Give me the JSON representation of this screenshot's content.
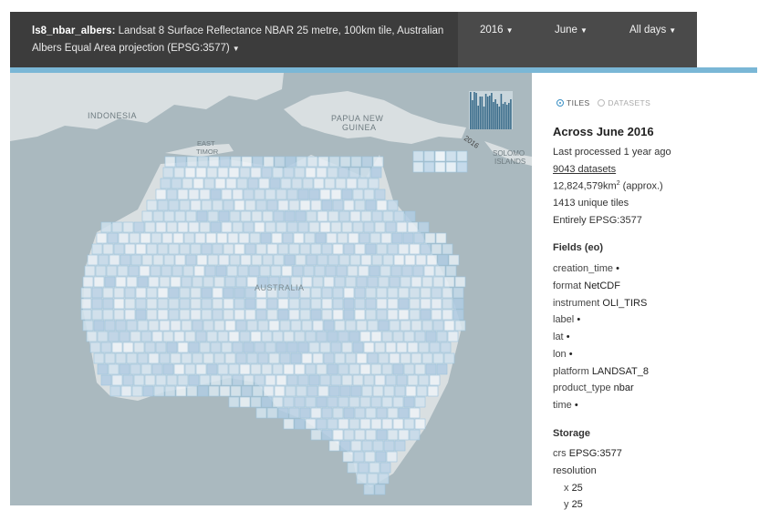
{
  "header": {
    "product_name": "ls8_nbar_albers:",
    "product_description": "Landsat 8 Surface Reflectance NBAR 25 metre, 100km tile, Australian Albers Equal Area projection (EPSG:3577)",
    "year": "2016",
    "month": "June",
    "day": "All days"
  },
  "map": {
    "labels": {
      "indonesia": "INDONESIA",
      "png1": "PAPUA NEW",
      "png2": "GUINEA",
      "timor1": "EAST",
      "timor2": "TIMOR",
      "solomon1": "SOLOMO",
      "solomon2": "ISLANDS",
      "australia": "AUSTRALIA",
      "histogram_year": "2016"
    },
    "colors": {
      "land": "#d9dfe1",
      "sea": "#aab9bf",
      "tile_stroke": "#9cc4dc",
      "histogram": "#3d6e8c"
    }
  },
  "panel": {
    "view_tiles": "TILES",
    "view_datasets": "DATASETS",
    "title": "Across June 2016",
    "last_processed": "Last processed 1 year ago",
    "datasets_link": "9043 datasets",
    "area": "12,824,579km",
    "area_sup": "2",
    "area_suffix": " (approx.)",
    "unique_tiles": "1413 unique tiles",
    "crs_note": "Entirely EPSG:3577",
    "fields_heading": "Fields (eo)",
    "fields": [
      {
        "key": "creation_time",
        "value": "•"
      },
      {
        "key": "format",
        "value": "NetCDF"
      },
      {
        "key": "instrument",
        "value": "OLI_TIRS"
      },
      {
        "key": "label",
        "value": "•"
      },
      {
        "key": "lat",
        "value": "•"
      },
      {
        "key": "lon",
        "value": "•"
      },
      {
        "key": "platform",
        "value": "LANDSAT_8"
      },
      {
        "key": "product_type",
        "value": "nbar"
      },
      {
        "key": "time",
        "value": "•"
      }
    ],
    "storage_heading": "Storage",
    "storage_crs_key": "crs",
    "storage_crs_value": "EPSG:3577",
    "resolution_label": "resolution",
    "res_x_key": "x",
    "res_x_value": "25",
    "res_y_key": "y",
    "res_y_value": "25"
  }
}
